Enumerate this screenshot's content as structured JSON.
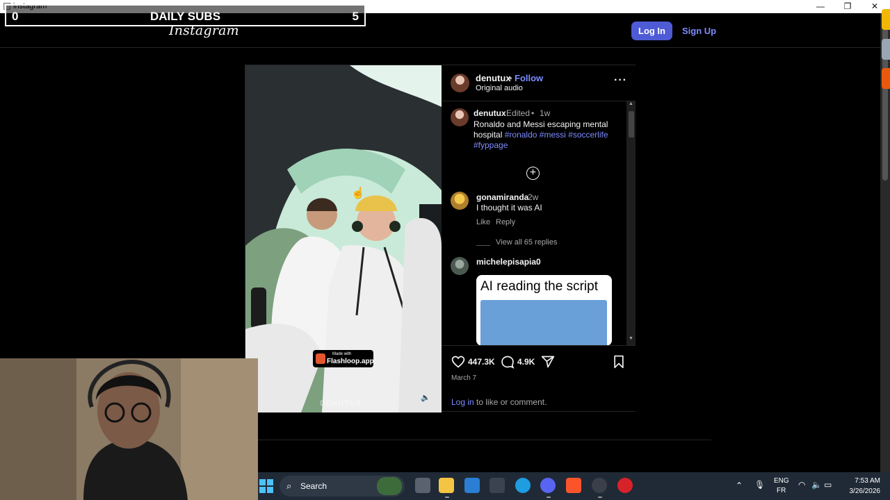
{
  "window": {
    "title": "instagram"
  },
  "overlay": {
    "left_count": "0",
    "label": "DAILY SUBS",
    "right_count": "5"
  },
  "nav": {
    "logo": "Instagram",
    "login": "Log In",
    "signup": "Sign Up"
  },
  "post": {
    "author": "denutux",
    "separator": "•",
    "follow": "Follow",
    "audio": "Original audio",
    "watermark": {
      "line1": "Made with",
      "line2": "Flashloop.app"
    },
    "video_credit": "DENUTUX",
    "caption": {
      "user": "denutux",
      "edited": "Edited",
      "separator": "•",
      "time": "1w",
      "text": "Ronaldo and Messi escaping mental hospital",
      "hashtags": [
        "#ronaldo",
        "#messi",
        "#soccerlife",
        "#fyppage"
      ]
    },
    "comments": [
      {
        "user": "gonamiranda",
        "time": "2w",
        "text": "I thought it was AI",
        "like": "Like",
        "reply": "Reply",
        "view_replies": "View all 65 replies"
      },
      {
        "user": "michelepisapia0",
        "meme_text": "AI reading the script"
      }
    ],
    "likes": "447.3K",
    "comment_count": "4.9K",
    "date": "March 7",
    "login_link": "Log in",
    "login_suffix": "to like or comment."
  },
  "taskbar": {
    "search": "Search",
    "lang": "ENG",
    "layout": "FR",
    "time": "7:53 AM",
    "date": "3/26/2026"
  },
  "colors": {
    "accent": "#4f5bd5",
    "link": "#7d8cff",
    "bg": "#000000",
    "taskbar": "#202a36"
  }
}
